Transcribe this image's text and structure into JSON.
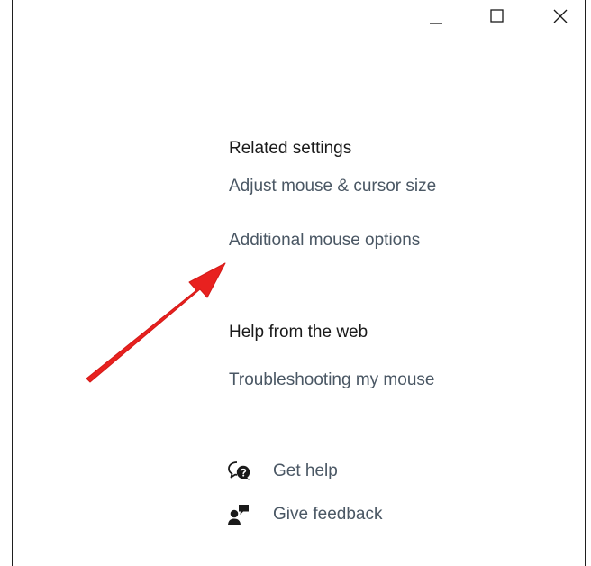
{
  "window_controls": {
    "minimize_icon": "minimize-icon",
    "maximize_icon": "maximize-icon",
    "close_icon": "close-icon"
  },
  "related_settings": {
    "heading": "Related settings",
    "links": [
      "Adjust mouse & cursor size",
      "Additional mouse options"
    ]
  },
  "help_from_web": {
    "heading": "Help from the web",
    "links": [
      "Troubleshooting my mouse"
    ]
  },
  "actions": {
    "get_help": {
      "label": "Get help",
      "icon": "get-help-icon"
    },
    "give_feedback": {
      "label": "Give feedback",
      "icon": "feedback-icon"
    }
  },
  "annotation": {
    "arrow_color": "#e8211f"
  },
  "colors": {
    "heading": "#1a1a1a",
    "link": "#4a5764"
  }
}
